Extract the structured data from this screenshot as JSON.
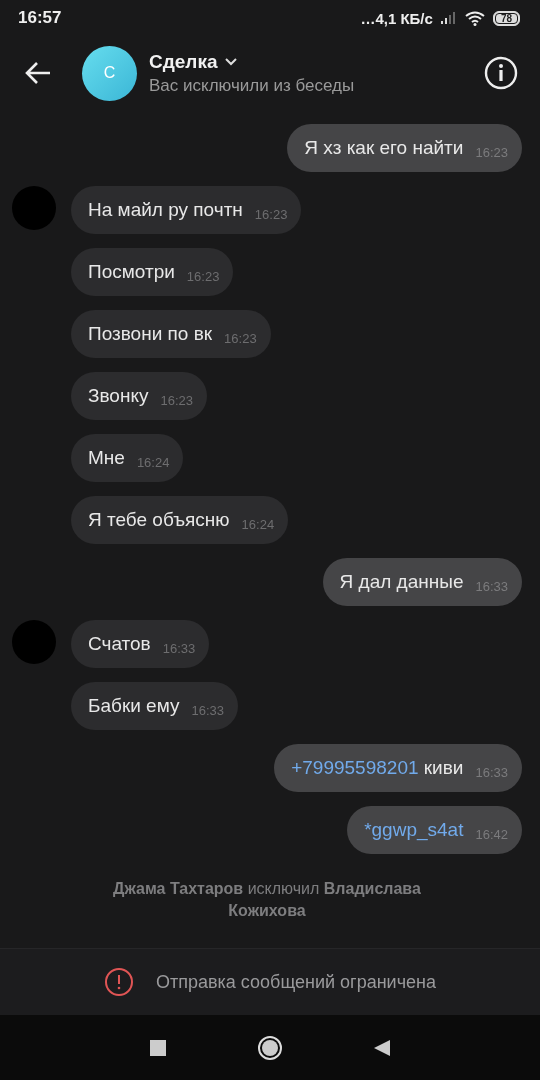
{
  "status_bar": {
    "time": "16:57",
    "network_speed": "…4,1 КБ/с",
    "battery": "78"
  },
  "header": {
    "avatar_letter": "С",
    "title": "Сделка",
    "subtitle": "Вас исключили из беседы"
  },
  "messages": [
    {
      "kind": "outgoing",
      "parts": [
        {
          "kind": "plain",
          "text": "Я хз как его найти"
        }
      ],
      "time": "16:23"
    },
    {
      "kind": "incoming",
      "avatar": true,
      "parts": [
        {
          "kind": "plain",
          "text": "На майл ру почтн"
        }
      ],
      "time": "16:23"
    },
    {
      "kind": "incoming",
      "avatar": false,
      "parts": [
        {
          "kind": "plain",
          "text": "Посмотри"
        }
      ],
      "time": "16:23"
    },
    {
      "kind": "incoming",
      "avatar": false,
      "parts": [
        {
          "kind": "plain",
          "text": "Позвони по вк"
        }
      ],
      "time": "16:23"
    },
    {
      "kind": "incoming",
      "avatar": false,
      "parts": [
        {
          "kind": "plain",
          "text": "Звонку"
        }
      ],
      "time": "16:23"
    },
    {
      "kind": "incoming",
      "avatar": false,
      "parts": [
        {
          "kind": "plain",
          "text": "Мне"
        }
      ],
      "time": "16:24"
    },
    {
      "kind": "incoming",
      "avatar": false,
      "parts": [
        {
          "kind": "plain",
          "text": "Я тебе объясню"
        }
      ],
      "time": "16:24"
    },
    {
      "kind": "outgoing",
      "parts": [
        {
          "kind": "plain",
          "text": "Я дал данные"
        }
      ],
      "time": "16:33"
    },
    {
      "kind": "incoming",
      "avatar": true,
      "parts": [
        {
          "kind": "plain",
          "text": "Счатов"
        }
      ],
      "time": "16:33"
    },
    {
      "kind": "incoming",
      "avatar": false,
      "parts": [
        {
          "kind": "plain",
          "text": "Бабки ему"
        }
      ],
      "time": "16:33"
    },
    {
      "kind": "outgoing",
      "parts": [
        {
          "kind": "link",
          "text": "+79995598201"
        },
        {
          "kind": "plain",
          "text": " киви"
        }
      ],
      "time": "16:33"
    },
    {
      "kind": "outgoing",
      "parts": [
        {
          "kind": "link",
          "text": "*ggwp_s4at"
        }
      ],
      "time": "16:42"
    }
  ],
  "system_message": "**Джама Тахтаров** исключил **Владислава Кожихова**",
  "footer": {
    "notice": "Отправка сообщений ограничена"
  }
}
